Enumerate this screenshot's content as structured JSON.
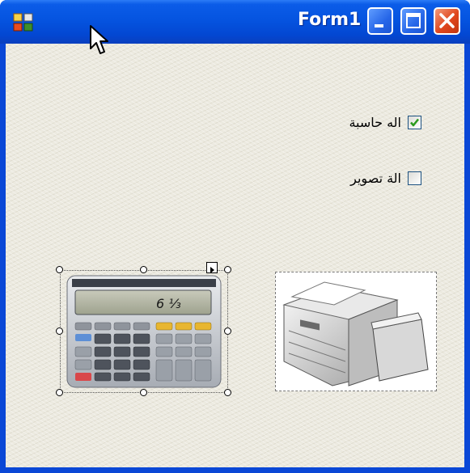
{
  "window": {
    "title": "Form1",
    "controls": [
      "minimize-icon",
      "maximize-icon",
      "close-icon"
    ]
  },
  "form": {
    "checkboxes": [
      {
        "label": "اله حاسبة",
        "checked": true
      },
      {
        "label": "الة تصوير",
        "checked": false
      }
    ],
    "pictures": [
      {
        "name": "calculator-image",
        "selected": true,
        "display_text": "6 ⅓"
      },
      {
        "name": "printer-image",
        "selected": false
      }
    ]
  },
  "colors": {
    "titlebar": "#0554e0",
    "client_bg": "#eceae0",
    "check_mark": "#2a9a1c"
  }
}
